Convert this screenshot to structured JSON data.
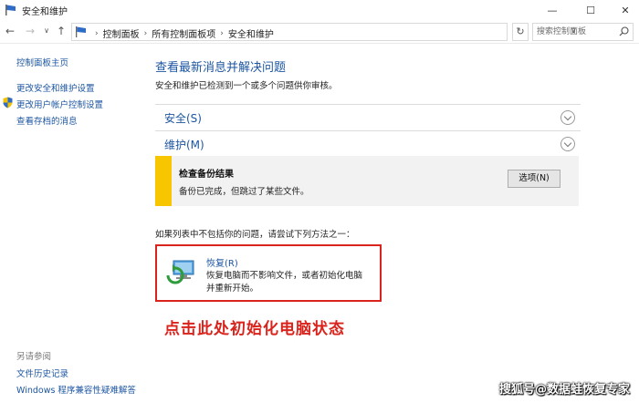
{
  "window": {
    "title": "安全和维护",
    "minimize": "—",
    "maximize": "☐",
    "close": "✕"
  },
  "nav": {
    "back": "←",
    "forward": "→",
    "dropdown": "∨",
    "up": "↑",
    "breadcrumbs": [
      "控制面板",
      "所有控制面板项",
      "安全和维护"
    ],
    "address_dropdown": "∨",
    "refresh": "↻",
    "search_placeholder": "搜索控制面板"
  },
  "sidebar": {
    "home": "控制面板主页",
    "change_settings": "更改安全和维护设置",
    "uac": "更改用户帐户控制设置",
    "archived": "查看存档的消息",
    "see_also": "另请参阅",
    "file_history": "文件历史记录",
    "compat": "Windows 程序兼容性疑难解答"
  },
  "main": {
    "heading": "查看最新消息并解决问题",
    "description": "安全和维护已检测到一个或多个问题供你审核。",
    "security_label": "安全(S)",
    "maintenance_label": "维护(M)",
    "alert": {
      "title": "检查备份结果",
      "text": "备份已完成，但跳过了某些文件。",
      "button": "选项(N)",
      "color": "#f7c600"
    },
    "hint": "如果列表中不包括你的问题，请尝试下列方法之一：",
    "recovery": {
      "title": "恢复(R)",
      "text": "恢复电脑而不影响文件，或者初始化电脑并重新开始。"
    }
  },
  "annotation": {
    "callout": "点击此处初始化电脑状态",
    "color": "#d9231d"
  },
  "watermark": "搜狐号@数据蛙恢复专家"
}
